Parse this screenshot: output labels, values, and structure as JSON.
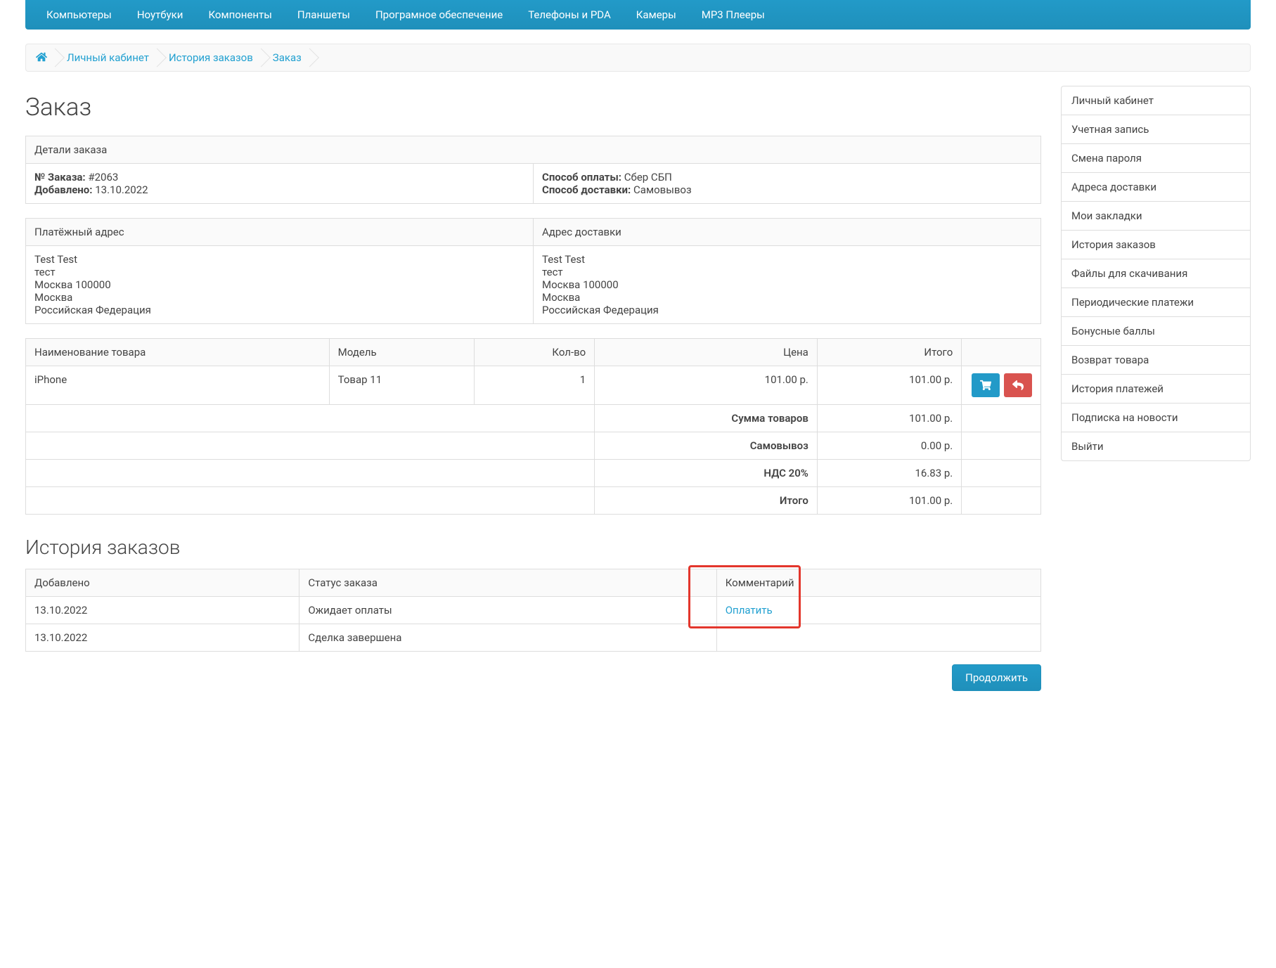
{
  "nav": [
    "Компьютеры",
    "Ноутбуки",
    "Компоненты",
    "Планшеты",
    "Програмное обеспечение",
    "Телефоны и PDA",
    "Камеры",
    "MP3 Плееры"
  ],
  "breadcrumb": {
    "home_icon": "home-icon",
    "items": [
      "Личный кабинет",
      "История заказов",
      "Заказ"
    ]
  },
  "page": {
    "title": "Заказ"
  },
  "order_details": {
    "header": "Детали заказа",
    "left": {
      "order_no_label": "№ Заказа:",
      "order_no_value": "#2063",
      "added_label": "Добавлено:",
      "added_value": "13.10.2022"
    },
    "right": {
      "payment_label": "Способ оплаты:",
      "payment_value": "Сбер СБП",
      "shipping_label": "Способ доставки:",
      "shipping_value": "Самовывоз"
    }
  },
  "addresses": {
    "billing_header": "Платёжный адрес",
    "shipping_header": "Адрес доставки",
    "billing": "Test Test\nтест\nМосква 100000\nМосква\nРоссийская Федерация",
    "shipping": "Test Test\nтест\nМосква 100000\nМосква\nРоссийская Федерация"
  },
  "products": {
    "cols": {
      "name": "Наименование товара",
      "model": "Модель",
      "qty": "Кол-во",
      "price": "Цена",
      "total": "Итого"
    },
    "rows": [
      {
        "name": "iPhone",
        "model": "Товар 11",
        "qty": "1",
        "price": "101.00 р.",
        "total": "101.00 р."
      }
    ],
    "totals": [
      {
        "label": "Сумма товаров",
        "value": "101.00 р."
      },
      {
        "label": "Самовывоз",
        "value": "0.00 р."
      },
      {
        "label": "НДС 20%",
        "value": "16.83 р."
      },
      {
        "label": "Итого",
        "value": "101.00 р."
      }
    ]
  },
  "history": {
    "title": "История заказов",
    "cols": {
      "added": "Добавлено",
      "status": "Статус заказа",
      "comment": "Комментарий"
    },
    "rows": [
      {
        "added": "13.10.2022",
        "status": "Ожидает оплаты",
        "comment_link": "Оплатить"
      },
      {
        "added": "13.10.2022",
        "status": "Сделка завершена",
        "comment_link": ""
      }
    ]
  },
  "continue": {
    "label": "Продолжить"
  },
  "sidebar": {
    "items": [
      "Личный кабинет",
      "Учетная запись",
      "Смена пароля",
      "Адреса доставки",
      "Мои закладки",
      "История заказов",
      "Файлы для скачивания",
      "Периодические платежи",
      "Бонусные баллы",
      "Возврат товара",
      "История платежей",
      "Подписка на новости",
      "Выйти"
    ]
  }
}
